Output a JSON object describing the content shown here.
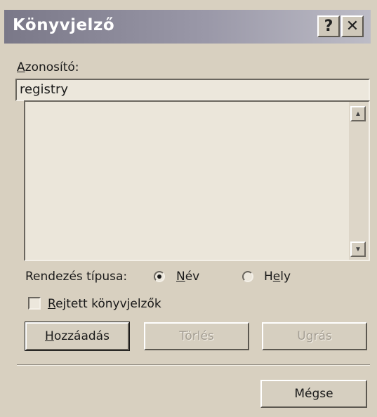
{
  "dialog": {
    "title": "Könyvjelző",
    "help_button": "?",
    "close_button": "✕"
  },
  "identifier": {
    "label_accel": "A",
    "label_rest": "zonosító:",
    "value": "registry"
  },
  "bookmark_list": {
    "items": []
  },
  "sort": {
    "label": "Rendezés típusa:",
    "options": [
      {
        "accel": "N",
        "rest": "év",
        "selected": true
      },
      {
        "pre": "H",
        "accel": "e",
        "rest": "ly",
        "selected": false
      }
    ]
  },
  "hidden_bookmarks": {
    "accel": "R",
    "rest": "ejtett könyvjelzők",
    "checked": false
  },
  "buttons": {
    "add_accel": "H",
    "add_rest": "ozzáadás",
    "delete": "Törlés",
    "goto": "Ugrás",
    "cancel": "Mégse"
  }
}
